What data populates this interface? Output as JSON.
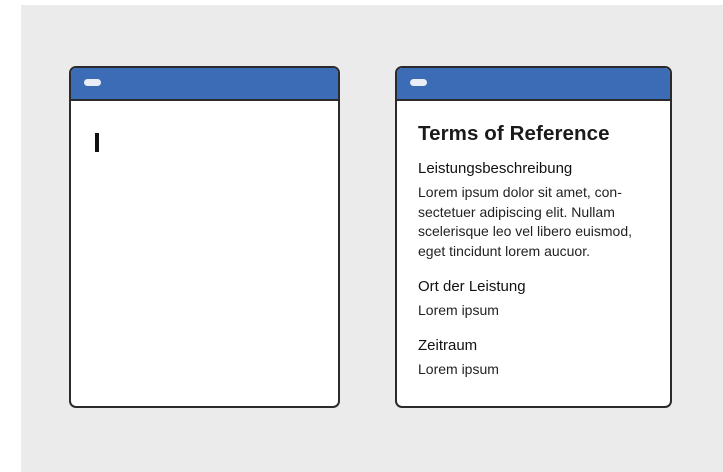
{
  "left_window": {
    "text_cursor": "I"
  },
  "right_window": {
    "title": "Terms of Reference",
    "sections": [
      {
        "heading": "Leistungsbeschreibung",
        "lines": [
          "Lorem ipsum dolor sit amet, con-",
          "sectetuer adipiscing elit. Nullam",
          "scelerisque leo vel libero euismod,",
          "eget tincidunt lorem aucuor."
        ]
      },
      {
        "heading": "Ort der Leistung",
        "lines": [
          "Lorem ipsum"
        ]
      },
      {
        "heading": "Zeitraum",
        "lines": [
          "Lorem ipsum"
        ]
      }
    ]
  },
  "colors": {
    "background": "#ebebeb",
    "titlebar": "#3d6cb6",
    "window_border": "#2b2b2b",
    "window_fill": "#ffffff"
  },
  "icons": {
    "titlebar_control": "window-control-pill-icon"
  }
}
